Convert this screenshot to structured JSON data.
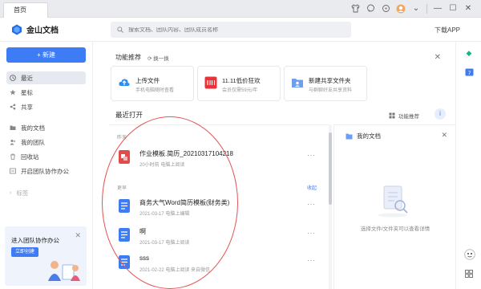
{
  "titlebar": {
    "tab": "首页"
  },
  "header": {
    "app_name": "金山文档",
    "search_placeholder": "搜索文档、团队内容、团队成员名称",
    "download": "下载APP"
  },
  "sidebar": {
    "new_label": "+ 新建",
    "items": [
      {
        "label": "最近",
        "icon": "clock-icon"
      },
      {
        "label": "星标",
        "icon": "star-icon"
      },
      {
        "label": "共享",
        "icon": "share-icon"
      },
      {
        "label": "我的文档",
        "icon": "folder-icon"
      },
      {
        "label": "我的团队",
        "icon": "team-icon"
      },
      {
        "label": "回收站",
        "icon": "trash-icon"
      },
      {
        "label": "开启团队协作办公",
        "icon": "collab-icon"
      }
    ],
    "tags_label": "标签",
    "team_card": {
      "title": "进入团队协作办公",
      "button": "立即创建"
    }
  },
  "feature": {
    "title": "功能推荐",
    "swap": "换一换",
    "cards": [
      {
        "title": "上传文件",
        "subtitle": "手机电脑随时查看"
      },
      {
        "title": "11.11低价狂欢",
        "subtitle": "会员仅需59元/年"
      },
      {
        "title": "新建共享文件夹",
        "subtitle": "与群聊好友共享资料"
      }
    ]
  },
  "recent": {
    "title": "最近打开",
    "feature_rec": "功能推荐",
    "sections": [
      {
        "label": "昨天"
      },
      {
        "label": "更早",
        "action": "收起"
      }
    ],
    "files": [
      {
        "name": "作业模板.简历_20210317104218",
        "meta": "20小时前  电脑上阅读",
        "type": "pdf"
      },
      {
        "name": "商务大气Word简历模板(财务类)",
        "meta": "2021-03-17  电脑上编辑",
        "type": "doc"
      },
      {
        "name": "啊",
        "meta": "2021-03-17  电脑上阅读",
        "type": "doc"
      },
      {
        "name": "sss",
        "meta": "2021-02-22  电脑上阅读  来自微信",
        "type": "doc"
      }
    ],
    "more": "···"
  },
  "detail": {
    "title": "我的文档",
    "empty_text": "选择文件/文件夹可以查看详情"
  },
  "colors": {
    "accent": "#3d7cf5",
    "annotation": "#e35454"
  }
}
